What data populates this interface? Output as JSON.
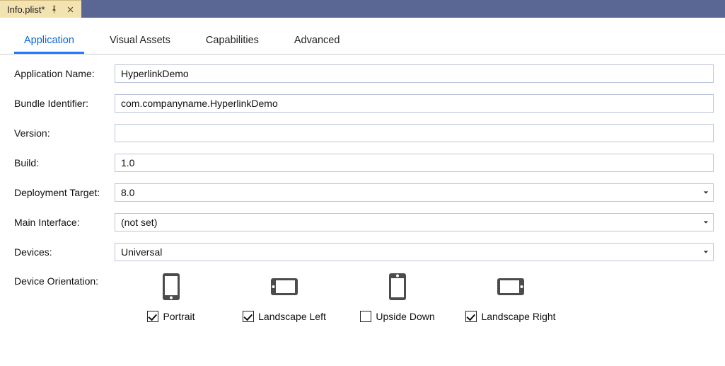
{
  "titlebar": {
    "tab_title": "Info.plist*"
  },
  "tabs": [
    {
      "label": "Application",
      "active": true
    },
    {
      "label": "Visual Assets",
      "active": false
    },
    {
      "label": "Capabilities",
      "active": false
    },
    {
      "label": "Advanced",
      "active": false
    }
  ],
  "form": {
    "app_name": {
      "label": "Application Name:",
      "value": "HyperlinkDemo"
    },
    "bundle_id": {
      "label": "Bundle Identifier:",
      "value": "com.companyname.HyperlinkDemo"
    },
    "version": {
      "label": "Version:",
      "value": ""
    },
    "build": {
      "label": "Build:",
      "value": "1.0"
    },
    "deployment_target": {
      "label": "Deployment Target:",
      "value": "8.0"
    },
    "main_interface": {
      "label": "Main Interface:",
      "value": "(not set)"
    },
    "devices": {
      "label": "Devices:",
      "value": "Universal"
    }
  },
  "orientation": {
    "label": "Device Orientation:",
    "options": [
      {
        "label": "Portrait",
        "checked": true
      },
      {
        "label": "Landscape Left",
        "checked": true
      },
      {
        "label": "Upside Down",
        "checked": false
      },
      {
        "label": "Landscape Right",
        "checked": true
      }
    ]
  }
}
